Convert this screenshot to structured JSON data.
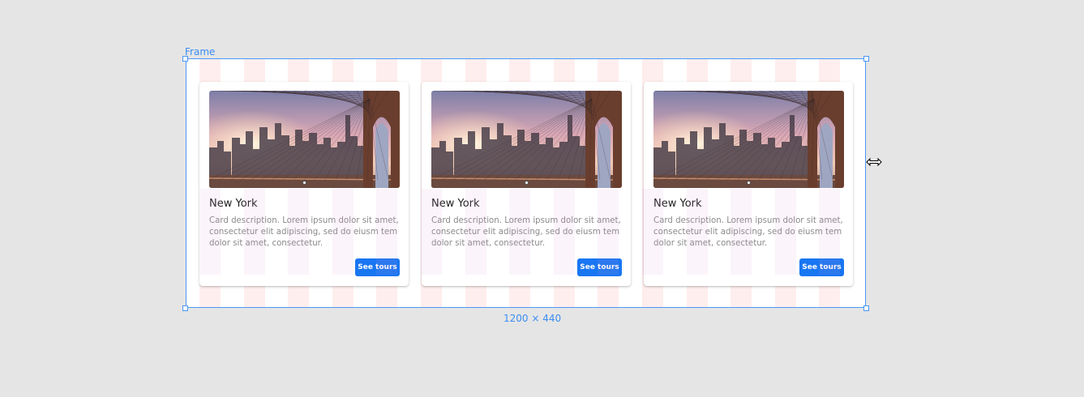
{
  "frame": {
    "name": "Frame",
    "dimensions": "1200 × 440"
  },
  "cards": [
    {
      "title": "New York",
      "description": "Card description. Lorem ipsum dolor sit amet, consectetur elit adipiscing, sed do eiusm tem dolor sit amet, consectetur.",
      "button": "See tours",
      "image": "brooklyn-bridge-photo"
    },
    {
      "title": "New York",
      "description": "Card description. Lorem ipsum dolor sit amet, consectetur elit adipiscing, sed do eiusm tem dolor sit amet, consectetur.",
      "button": "See tours",
      "image": "brooklyn-bridge-photo"
    },
    {
      "title": "New York",
      "description": "Card description. Lorem ipsum dolor sit amet, consectetur elit adipiscing, sed do eiusm tem dolor sit amet, consectetur.",
      "button": "See tours",
      "image": "brooklyn-bridge-photo"
    }
  ],
  "colors": {
    "selection": "#4a97f5",
    "button": "#1976f2",
    "canvas": "#e5e5e5"
  }
}
